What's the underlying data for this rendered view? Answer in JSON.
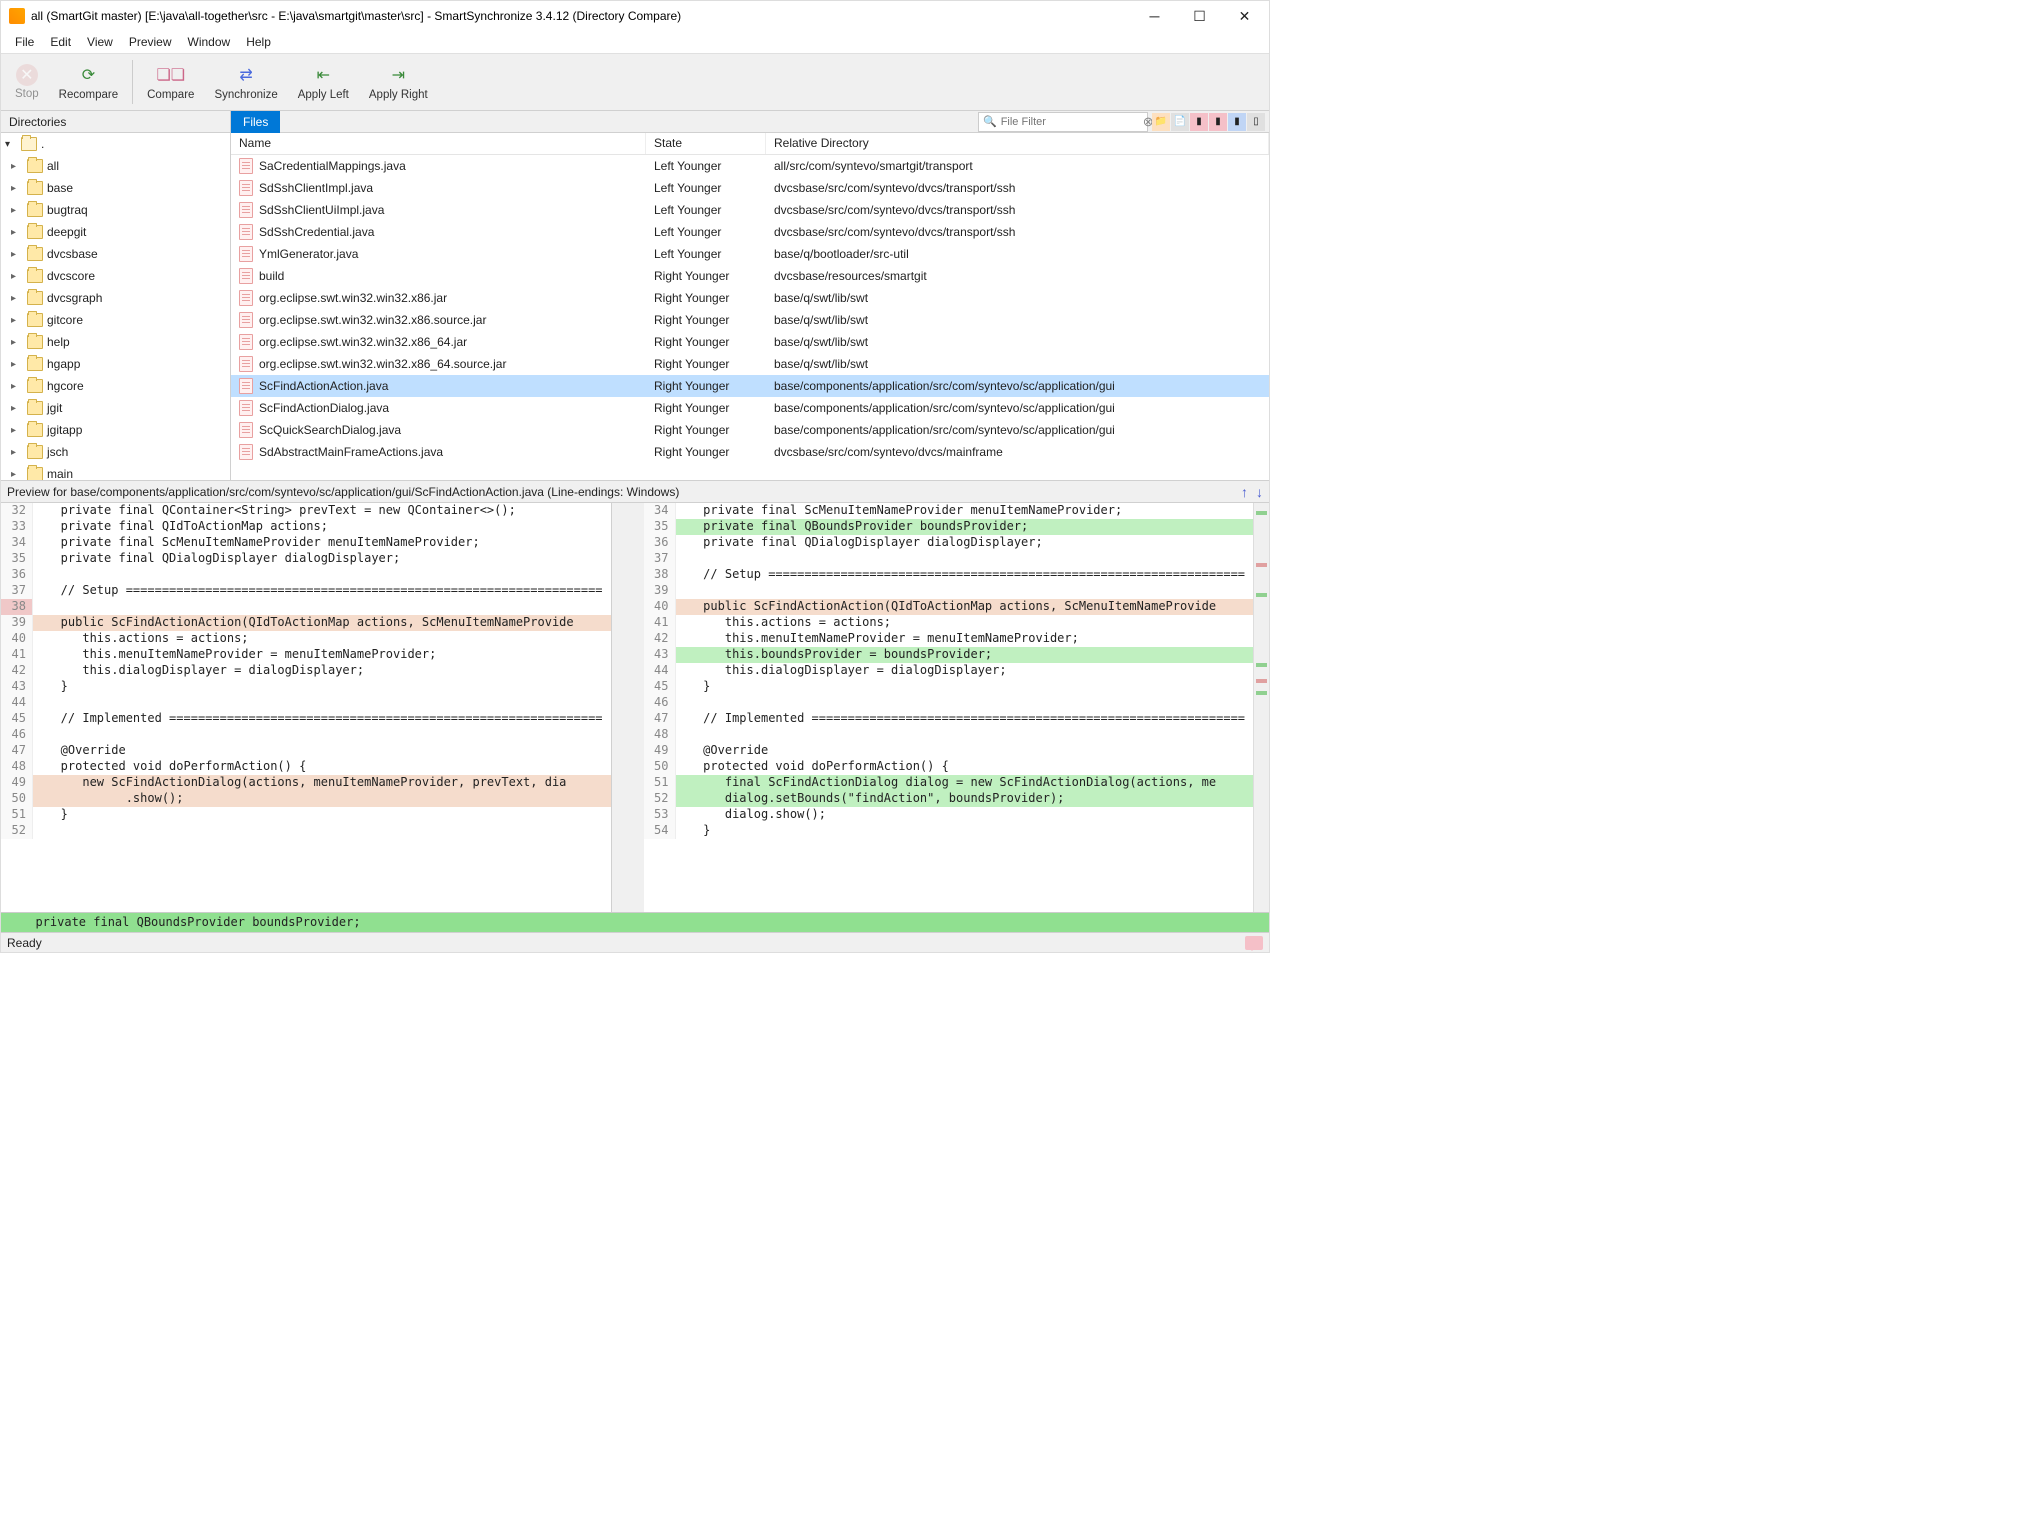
{
  "window": {
    "title": "all (SmartGit master) [E:\\java\\all-together\\src - E:\\java\\smartgit\\master\\src] - SmartSynchronize 3.4.12 (Directory Compare)"
  },
  "menu": [
    "File",
    "Edit",
    "View",
    "Preview",
    "Window",
    "Help"
  ],
  "toolbar": {
    "stop": "Stop",
    "recompare": "Recompare",
    "compare": "Compare",
    "synchronize": "Synchronize",
    "applyLeft": "Apply Left",
    "applyRight": "Apply Right"
  },
  "dirPanel": {
    "header": "Directories",
    "root": ".",
    "items": [
      "all",
      "base",
      "bugtraq",
      "deepgit",
      "dvcsbase",
      "dvcscore",
      "dvcsgraph",
      "gitcore",
      "help",
      "hgapp",
      "hgcore",
      "jgit",
      "jgitapp",
      "jsch",
      "main"
    ]
  },
  "filesPanel": {
    "tab": "Files",
    "filterPlaceholder": "File Filter",
    "columns": {
      "name": "Name",
      "state": "State",
      "rel": "Relative Directory"
    },
    "rows": [
      {
        "name": "SaCredentialMappings.java",
        "state": "Left Younger",
        "rel": "all/src/com/syntevo/smartgit/transport"
      },
      {
        "name": "SdSshClientImpl.java",
        "state": "Left Younger",
        "rel": "dvcsbase/src/com/syntevo/dvcs/transport/ssh"
      },
      {
        "name": "SdSshClientUiImpl.java",
        "state": "Left Younger",
        "rel": "dvcsbase/src/com/syntevo/dvcs/transport/ssh"
      },
      {
        "name": "SdSshCredential.java",
        "state": "Left Younger",
        "rel": "dvcsbase/src/com/syntevo/dvcs/transport/ssh"
      },
      {
        "name": "YmlGenerator.java",
        "state": "Left Younger",
        "rel": "base/q/bootloader/src-util"
      },
      {
        "name": "build",
        "state": "Right Younger",
        "rel": "dvcsbase/resources/smartgit"
      },
      {
        "name": "org.eclipse.swt.win32.win32.x86.jar",
        "state": "Right Younger",
        "rel": "base/q/swt/lib/swt"
      },
      {
        "name": "org.eclipse.swt.win32.win32.x86.source.jar",
        "state": "Right Younger",
        "rel": "base/q/swt/lib/swt"
      },
      {
        "name": "org.eclipse.swt.win32.win32.x86_64.jar",
        "state": "Right Younger",
        "rel": "base/q/swt/lib/swt"
      },
      {
        "name": "org.eclipse.swt.win32.win32.x86_64.source.jar",
        "state": "Right Younger",
        "rel": "base/q/swt/lib/swt"
      },
      {
        "name": "ScFindActionAction.java",
        "state": "Right Younger",
        "rel": "base/components/application/src/com/syntevo/sc/application/gui",
        "selected": true
      },
      {
        "name": "ScFindActionDialog.java",
        "state": "Right Younger",
        "rel": "base/components/application/src/com/syntevo/sc/application/gui"
      },
      {
        "name": "ScQuickSearchDialog.java",
        "state": "Right Younger",
        "rel": "base/components/application/src/com/syntevo/sc/application/gui"
      },
      {
        "name": "SdAbstractMainFrameActions.java",
        "state": "Right Younger",
        "rel": "dvcsbase/src/com/syntevo/dvcs/mainframe"
      }
    ]
  },
  "preview": {
    "header": "Preview for base/components/application/src/com/syntevo/sc/application/gui/ScFindActionAction.java (Line-endings: Windows)",
    "left": [
      {
        "n": 32,
        "t": "   private final QContainer<String> prevText = new QContainer<>();"
      },
      {
        "n": 33,
        "t": "   private final QIdToActionMap actions;"
      },
      {
        "n": 34,
        "t": "   private final ScMenuItemNameProvider menuItemNameProvider;"
      },
      {
        "n": 35,
        "t": "   private final QDialogDisplayer dialogDisplayer;"
      },
      {
        "n": 36,
        "t": ""
      },
      {
        "n": 37,
        "t": "   // Setup =================================================================="
      },
      {
        "n": 38,
        "t": "",
        "lnc": "changed"
      },
      {
        "n": 39,
        "t": "   public ScFindActionAction(QIdToActionMap actions, ScMenuItemNameProvide",
        "c": "changed"
      },
      {
        "n": 40,
        "t": "      this.actions = actions;"
      },
      {
        "n": 41,
        "t": "      this.menuItemNameProvider = menuItemNameProvider;"
      },
      {
        "n": 42,
        "t": "      this.dialogDisplayer = dialogDisplayer;"
      },
      {
        "n": 43,
        "t": "   }"
      },
      {
        "n": 44,
        "t": ""
      },
      {
        "n": 45,
        "t": "   // Implemented ============================================================"
      },
      {
        "n": 46,
        "t": ""
      },
      {
        "n": 47,
        "t": "   @Override"
      },
      {
        "n": 48,
        "t": "   protected void doPerformAction() {"
      },
      {
        "n": 49,
        "t": "      new ScFindActionDialog(actions, menuItemNameProvider, prevText, dia",
        "c": "changed"
      },
      {
        "n": 50,
        "t": "            .show();",
        "c": "changed"
      },
      {
        "n": 51,
        "t": "   }"
      },
      {
        "n": 52,
        "t": ""
      }
    ],
    "right": [
      {
        "n": 34,
        "t": "   private final ScMenuItemNameProvider menuItemNameProvider;"
      },
      {
        "n": 35,
        "t": "   private final QBoundsProvider boundsProvider;",
        "c": "added"
      },
      {
        "n": 36,
        "t": "   private final QDialogDisplayer dialogDisplayer;"
      },
      {
        "n": 37,
        "t": ""
      },
      {
        "n": 38,
        "t": "   // Setup =================================================================="
      },
      {
        "n": 39,
        "t": ""
      },
      {
        "n": 40,
        "t": "   public ScFindActionAction(QIdToActionMap actions, ScMenuItemNameProvide",
        "c": "changed"
      },
      {
        "n": 41,
        "t": "      this.actions = actions;"
      },
      {
        "n": 42,
        "t": "      this.menuItemNameProvider = menuItemNameProvider;"
      },
      {
        "n": 43,
        "t": "      this.boundsProvider = boundsProvider;",
        "c": "added"
      },
      {
        "n": 44,
        "t": "      this.dialogDisplayer = dialogDisplayer;"
      },
      {
        "n": 45,
        "t": "   }"
      },
      {
        "n": 46,
        "t": ""
      },
      {
        "n": 47,
        "t": "   // Implemented ============================================================"
      },
      {
        "n": 48,
        "t": ""
      },
      {
        "n": 49,
        "t": "   @Override"
      },
      {
        "n": 50,
        "t": "   protected void doPerformAction() {"
      },
      {
        "n": 51,
        "t": "      final ScFindActionDialog dialog = new ScFindActionDialog(actions, me",
        "c": "added"
      },
      {
        "n": 52,
        "t": "      dialog.setBounds(\"findAction\", boundsProvider);",
        "c": "added"
      },
      {
        "n": 53,
        "t": "      dialog.show();"
      },
      {
        "n": 54,
        "t": "   }"
      }
    ],
    "bottomLine": "  private final QBoundsProvider boundsProvider;"
  },
  "status": "Ready"
}
